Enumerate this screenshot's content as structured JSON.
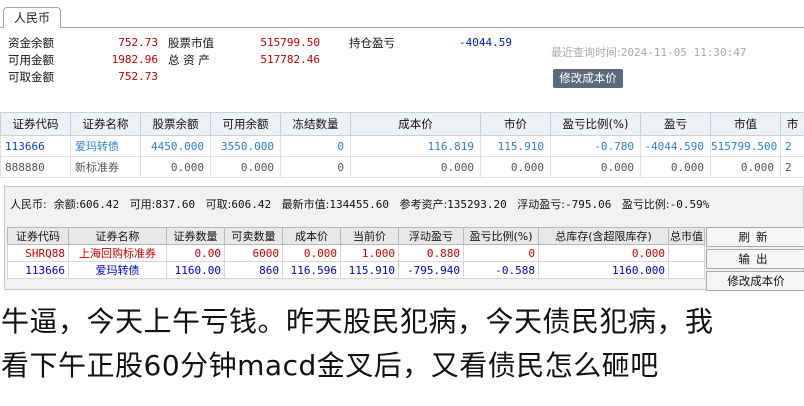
{
  "top": {
    "tab_label": "人民币",
    "fund_balance_label": "资金余额",
    "fund_balance": "752.73",
    "available_label": "可用金额",
    "available": "1982.96",
    "withdrawable_label": "可取金额",
    "withdrawable": "752.73",
    "market_value_label": "股票市值",
    "market_value": "515799.50",
    "total_assets_label": "总 资 产",
    "total_assets": "517782.46",
    "position_pl_label": "持仓盈亏",
    "position_pl": "-4044.59",
    "query_time_label": "最近查询时间:",
    "query_time": "2024-11-05 11:30:47",
    "modify_cost_button": "修改成本价",
    "columns": [
      "证券代码",
      "证券名称",
      "股票余额",
      "可用余额",
      "冻结数量",
      "成本价",
      "市价",
      "盈亏比例(%)",
      "盈亏",
      "市值",
      "市"
    ],
    "rows": [
      [
        "113666",
        "爱玛转债",
        "4450.000",
        "3550.000",
        "0",
        "116.819",
        "115.910",
        "-0.780",
        "-4044.590",
        "515799.500",
        "2"
      ],
      [
        "888880",
        "新标准券",
        "0.000",
        "0.000",
        "0",
        "0.000",
        "0.000",
        "0.000",
        "0.000",
        "0.000",
        "2"
      ]
    ]
  },
  "panel2": {
    "currency": "人民币:",
    "balance_label": "余额:",
    "balance": "606.42",
    "available_label": "可用:",
    "available": "837.60",
    "withdrawable_label": "可取:",
    "withdrawable": "606.42",
    "latest_mv_label": "最新市值:",
    "latest_mv": "134455.60",
    "ref_assets_label": "参考资产:",
    "ref_assets": "135293.20",
    "float_pl_label": "浮动盈亏:",
    "float_pl": "-795.06",
    "pl_ratio_label": "盈亏比例:",
    "pl_ratio": "-0.59%",
    "columns": [
      "证券代码",
      "证券名称",
      "证券数量",
      "可卖数量",
      "成本价",
      "当前价",
      "浮动盈亏",
      "盈亏比例(%)",
      "总库存(含超限库存)",
      "总市值"
    ],
    "rows": [
      [
        "SHRQ88",
        "上海回购标准券",
        "0.00",
        "6000",
        "0.000",
        "1.000",
        "0.880",
        "0",
        "0.000",
        ""
      ],
      [
        "113666",
        "爱玛转债",
        "1160.00",
        "860",
        "116.596",
        "115.910",
        "-795.940",
        "-0.588",
        "1160.000",
        ""
      ]
    ],
    "buttons": [
      "刷新",
      "输出",
      "修改成本价"
    ]
  },
  "caption": {
    "line1": "牛逼，今天上午亏钱。昨天股民犯病，今天债民犯病，我",
    "line2": "看下午正股60分钟macd金叉后，又看债民怎么砸吧"
  }
}
